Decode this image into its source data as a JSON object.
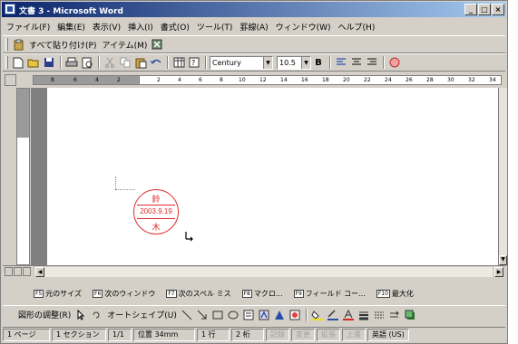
{
  "window": {
    "title": "文書 3 - Microsoft Word",
    "buttons": {
      "minimize": "_",
      "maximize": "□",
      "close": "×"
    }
  },
  "menu": [
    "ファイル(F)",
    "編集(E)",
    "表示(V)",
    "挿入(I)",
    "書式(O)",
    "ツール(T)",
    "罫線(A)",
    "ウィンドウ(W)",
    "ヘルプ(H)"
  ],
  "clipboard_toolbar": {
    "paste_all": "すべて貼り付け(P)",
    "items": "アイテム(M)"
  },
  "format_toolbar": {
    "font_name": "Century",
    "font_size": "10.5",
    "bold": "B"
  },
  "ruler": {
    "ticks": [
      "8",
      "6",
      "4",
      "2",
      "2",
      "4",
      "6",
      "8",
      "10",
      "12",
      "14",
      "16",
      "18",
      "20",
      "22",
      "24",
      "26",
      "28",
      "30",
      "32",
      "34"
    ]
  },
  "stamp": {
    "top": "鈴",
    "date": "2003.9.19",
    "bottom": "木",
    "color": "#e02a2a"
  },
  "function_keys": [
    {
      "key": "F5",
      "label": "元のサイズ"
    },
    {
      "key": "F6",
      "label": "次のウィンドウ"
    },
    {
      "key": "F7",
      "label": "次のスペル ミス"
    },
    {
      "key": "F8",
      "label": "マクロ..."
    },
    {
      "key": "F9",
      "label": "フィールド コー..."
    },
    {
      "key": "F10",
      "label": "最大化"
    }
  ],
  "drawing_toolbar": {
    "draw": "図形の調整(R)",
    "autoshapes": "オートシェイプ(U)"
  },
  "status": {
    "page": "1 ページ",
    "section": "1 セクション",
    "page_of": "1/1",
    "position": "位置 34mm",
    "line": "1 行",
    "column": "2 桁",
    "rec": "記録",
    "trk": "変更",
    "ext": "拡張",
    "ovr": "上書",
    "language": "英語 (US)"
  },
  "colors": {
    "title_start": "#0a246a",
    "title_end": "#a6caf0",
    "face": "#d4d0c8"
  }
}
